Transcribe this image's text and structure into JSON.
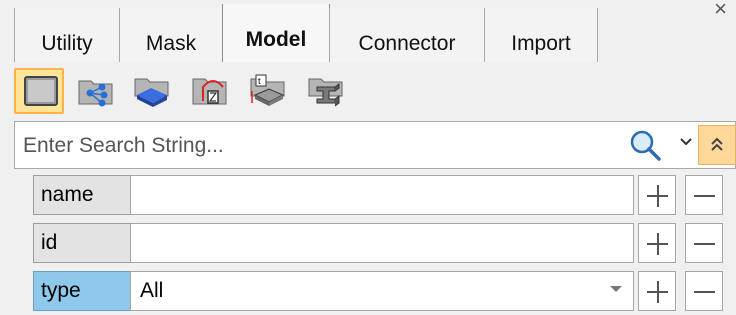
{
  "tabs": [
    {
      "label": "Utility",
      "active": false
    },
    {
      "label": "Mask",
      "active": false
    },
    {
      "label": "Model",
      "active": true
    },
    {
      "label": "Connector",
      "active": false
    },
    {
      "label": "Import",
      "active": false
    }
  ],
  "window": {
    "close_glyph": "×"
  },
  "toolbar": {
    "tools": [
      {
        "icon": "model-browser-icon",
        "active": true
      },
      {
        "icon": "component-tree-icon",
        "active": false
      },
      {
        "icon": "solid-block-icon",
        "active": false
      },
      {
        "icon": "dimension-icon",
        "active": false
      },
      {
        "icon": "thickness-icon",
        "active": false
      },
      {
        "icon": "beam-section-icon",
        "active": false
      }
    ]
  },
  "search": {
    "placeholder": "Enter Search String..."
  },
  "filters": [
    {
      "label": "name",
      "value": ""
    },
    {
      "label": "id",
      "value": ""
    },
    {
      "label": "type",
      "value": "All"
    }
  ],
  "colors": {
    "active_accent": "#ffb24a",
    "highlight_label": "#8ec8ea"
  }
}
